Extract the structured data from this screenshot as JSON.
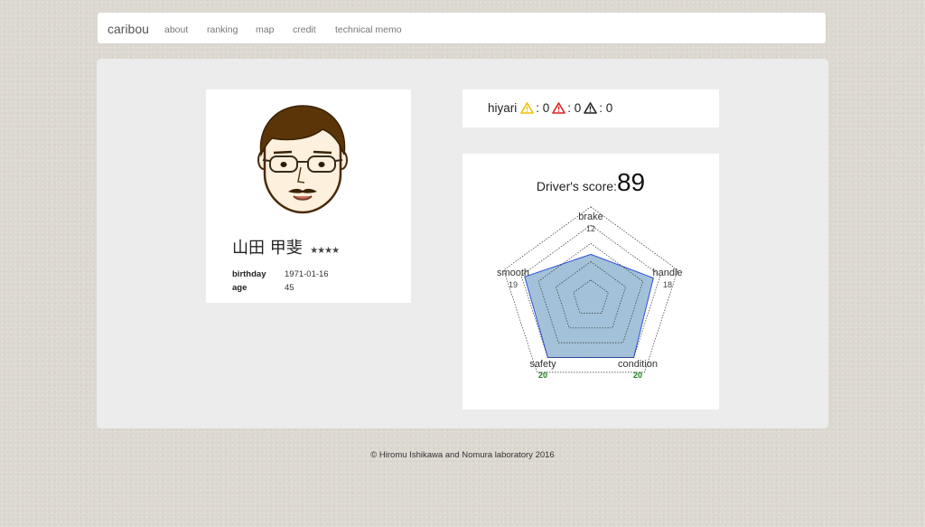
{
  "navbar": {
    "brand": "caribou",
    "links": [
      "about",
      "ranking",
      "map",
      "credit",
      "technical memo"
    ]
  },
  "profile": {
    "avatar_icon": "person-face-avatar-icon",
    "name": "山田 甲斐",
    "rating_stars": "★★★★",
    "fields": [
      {
        "label": "birthday",
        "value": "1971-01-16"
      },
      {
        "label": "age",
        "value": "45"
      }
    ]
  },
  "hiyari": {
    "label": "hiyari",
    "counts": [
      {
        "icon": "warning-yellow-icon",
        "color": "#f0c000",
        "value": ": 0"
      },
      {
        "icon": "warning-red-icon",
        "color": "#e02020",
        "value": ": 0"
      },
      {
        "icon": "warning-black-icon",
        "color": "#222222",
        "value": ": 0"
      }
    ]
  },
  "score": {
    "label": "Driver's score:",
    "value": "89"
  },
  "chart_data": {
    "type": "radar",
    "axes": [
      "brake",
      "handle",
      "condition",
      "safety",
      "smooth"
    ],
    "values": [
      12,
      18,
      20,
      20,
      19
    ],
    "value_labels": [
      "12",
      "18",
      "20",
      "20",
      "19"
    ],
    "max": 20,
    "grid_levels": 4,
    "fill_color": "#a3c2d9",
    "stroke_color": "#2e4fd8",
    "highlight_color": "#1a7a1a"
  },
  "footer": {
    "text": "© Hiromu Ishikawa and Nomura laboratory 2016"
  }
}
